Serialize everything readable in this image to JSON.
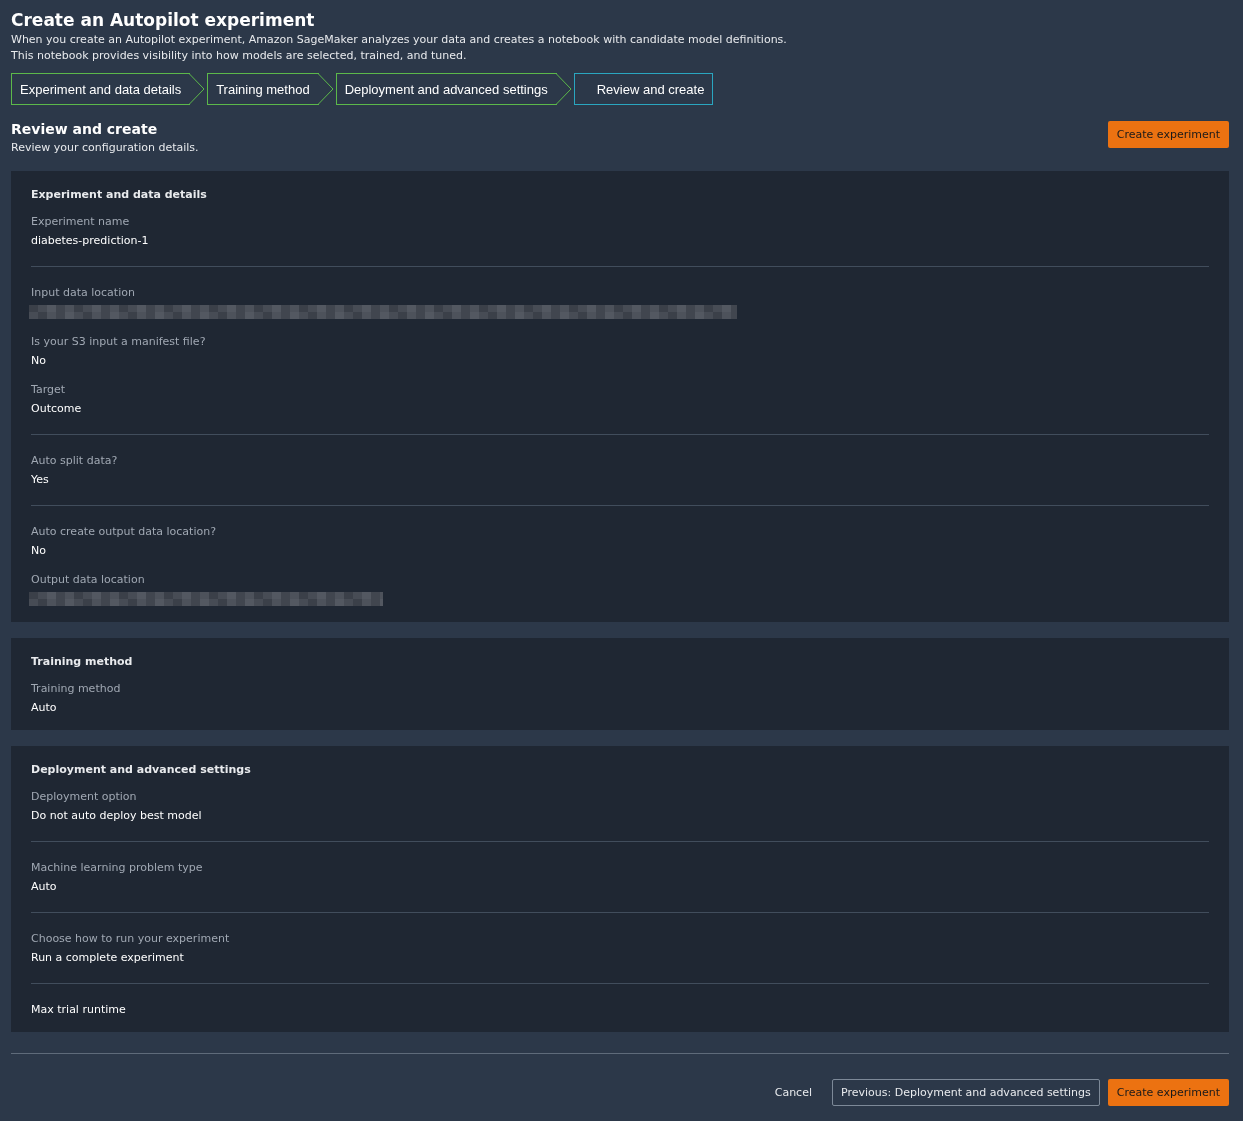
{
  "page": {
    "title": "Create an Autopilot experiment",
    "description": [
      "When you create an Autopilot experiment, Amazon SageMaker analyzes your data and creates a notebook with candidate model definitions.",
      "This notebook provides visibility into how models are selected, trained, and tuned."
    ]
  },
  "steps": [
    {
      "label": "Experiment and data details",
      "selected": false
    },
    {
      "label": "Training method",
      "selected": false
    },
    {
      "label": "Deployment and advanced settings",
      "selected": false
    },
    {
      "label": "Review and create",
      "selected": true
    }
  ],
  "review": {
    "title": "Review and create",
    "subtitle": "Review your configuration details.",
    "primary_button": "Create experiment"
  },
  "sections": [
    {
      "title": "Experiment and data details",
      "groups": [
        [
          {
            "label": "Experiment name",
            "kind": "text",
            "value": "diabetes-prediction-1"
          }
        ],
        [
          {
            "label": "Input data location",
            "kind": "redacted",
            "level": 0.6
          },
          {
            "label": "Is your S3 input a manifest file?",
            "kind": "text",
            "value": "No"
          },
          {
            "label": "Target",
            "kind": "text",
            "value": "Outcome"
          }
        ],
        [
          {
            "label": "Auto split data?",
            "kind": "text",
            "value": "Yes"
          }
        ],
        [
          {
            "label": "Auto create output data location?",
            "kind": "text",
            "value": "No"
          },
          {
            "label": "Output data location",
            "kind": "redacted",
            "level": 0.3
          }
        ]
      ]
    },
    {
      "title": "Training method",
      "groups": [
        [
          {
            "label": "Training method",
            "kind": "text",
            "value": "Auto"
          }
        ]
      ]
    },
    {
      "title": "Deployment and advanced settings",
      "groups": [
        [
          {
            "label": "Deployment option",
            "kind": "text",
            "value": "Do not auto deploy best model"
          }
        ],
        [
          {
            "label": "Machine learning problem type",
            "kind": "text",
            "value": "Auto"
          }
        ],
        [
          {
            "label": "Choose how to run your experiment",
            "kind": "text",
            "value": "Run a complete experiment"
          }
        ],
        [
          {
            "label": "Max trial runtime",
            "kind": "label"
          }
        ]
      ]
    }
  ],
  "footer": {
    "cancel": "Cancel",
    "previous": "Previous: Deployment and advanced settings",
    "create": "Create experiment"
  }
}
